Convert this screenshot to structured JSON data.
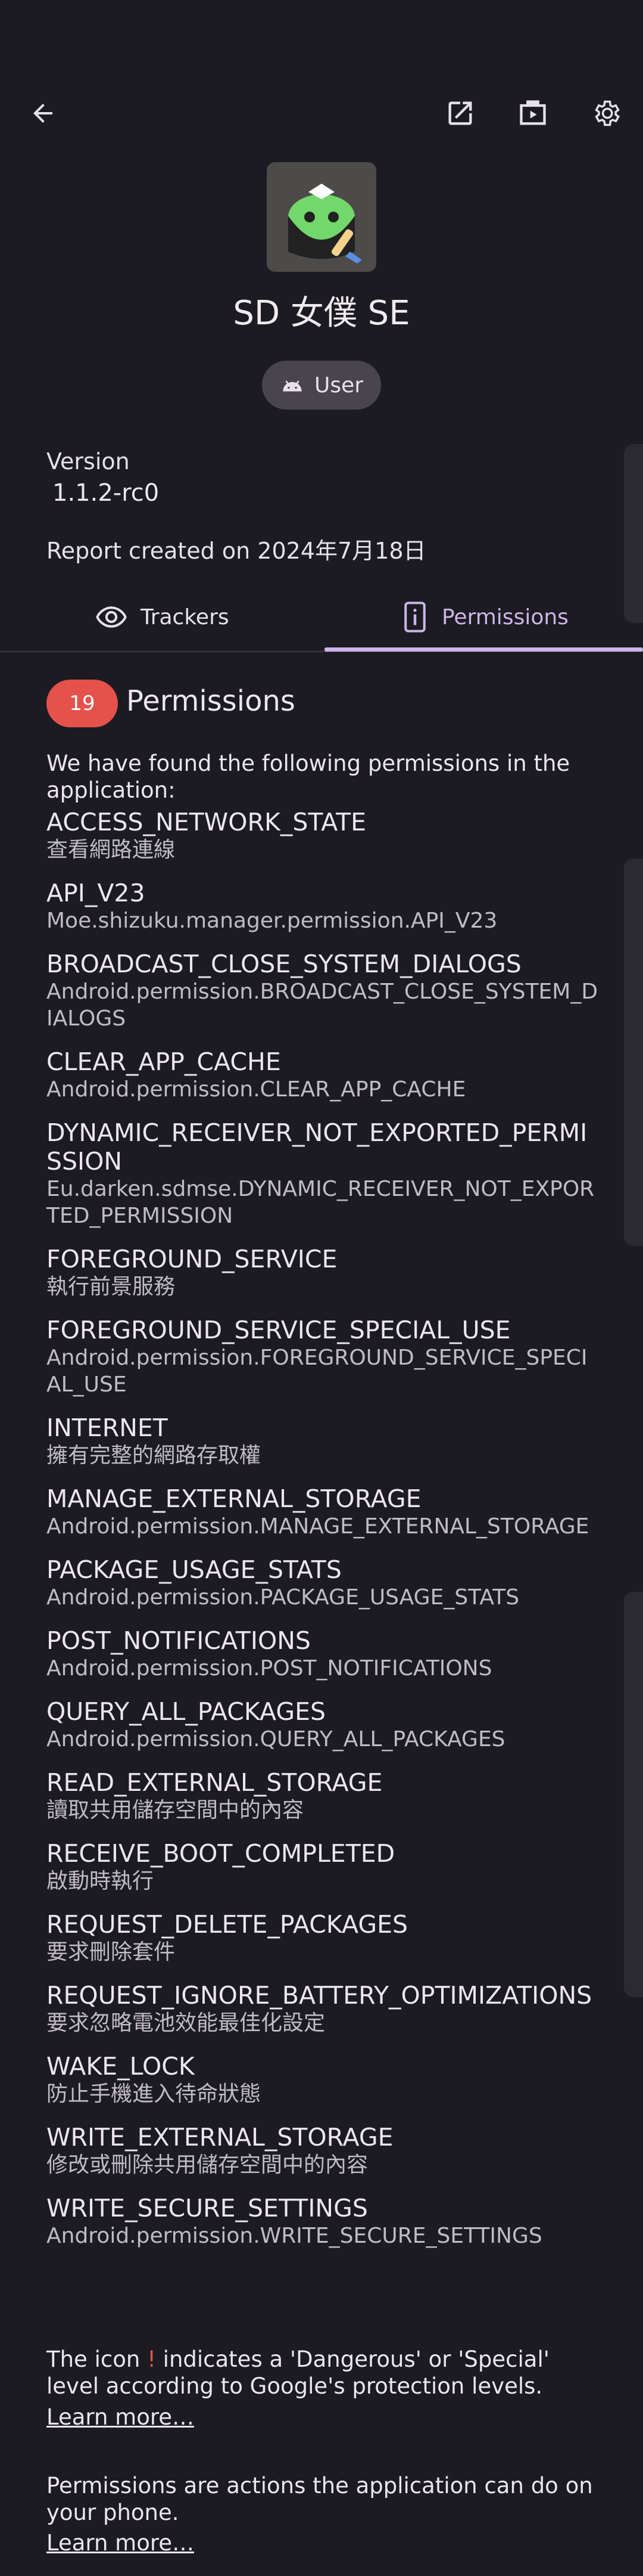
{
  "header": {
    "back_icon": "arrow-left-icon",
    "open_icon": "open-external-icon",
    "store_icon": "app-store-icon",
    "settings_icon": "gear-icon"
  },
  "app": {
    "name": "SD 女僕 SE",
    "type_label": "User"
  },
  "info": {
    "version_label": "Version",
    "version_value": "1.1.2-rc0",
    "report_created": "Report created on 2024年7月18日"
  },
  "tabs": [
    {
      "label": "Trackers",
      "icon": "eye-icon",
      "selected": false
    },
    {
      "label": "Permissions",
      "icon": "phone-info-icon",
      "selected": true
    }
  ],
  "permissions": {
    "count": "19",
    "title": "Permissions",
    "intro": "We have found the following permissions in the application:",
    "items": [
      {
        "name": "ACCESS_NETWORK_STATE",
        "desc": "查看網路連線"
      },
      {
        "name": "API_V23",
        "desc": "Moe.shizuku.manager.permission.API_V23"
      },
      {
        "name": "BROADCAST_CLOSE_SYSTEM_DIALOGS",
        "desc": "Android.permission.BROADCAST_CLOSE_SYSTEM_DIALOGS"
      },
      {
        "name": "CLEAR_APP_CACHE",
        "desc": "Android.permission.CLEAR_APP_CACHE"
      },
      {
        "name": "DYNAMIC_RECEIVER_NOT_EXPORTED_PERMISSION",
        "desc": "Eu.darken.sdmse.DYNAMIC_RECEIVER_NOT_EXPORTED_PERMISSION"
      },
      {
        "name": "FOREGROUND_SERVICE",
        "desc": "執行前景服務"
      },
      {
        "name": "FOREGROUND_SERVICE_SPECIAL_USE",
        "desc": "Android.permission.FOREGROUND_SERVICE_SPECIAL_USE"
      },
      {
        "name": "INTERNET",
        "desc": "擁有完整的網路存取權"
      },
      {
        "name": "MANAGE_EXTERNAL_STORAGE",
        "desc": "Android.permission.MANAGE_EXTERNAL_STORAGE"
      },
      {
        "name": "PACKAGE_USAGE_STATS",
        "desc": "Android.permission.PACKAGE_USAGE_STATS"
      },
      {
        "name": "POST_NOTIFICATIONS",
        "desc": "Android.permission.POST_NOTIFICATIONS"
      },
      {
        "name": "QUERY_ALL_PACKAGES",
        "desc": "Android.permission.QUERY_ALL_PACKAGES"
      },
      {
        "name": "READ_EXTERNAL_STORAGE",
        "desc": "讀取共用儲存空間中的內容"
      },
      {
        "name": "RECEIVE_BOOT_COMPLETED",
        "desc": "啟動時執行"
      },
      {
        "name": "REQUEST_DELETE_PACKAGES",
        "desc": "要求刪除套件"
      },
      {
        "name": "REQUEST_IGNORE_BATTERY_OPTIMIZATIONS",
        "desc": "要求忽略電池效能最佳化設定"
      },
      {
        "name": "WAKE_LOCK",
        "desc": "防止手機進入待命狀態"
      },
      {
        "name": "WRITE_EXTERNAL_STORAGE",
        "desc": "修改或刪除共用儲存空間中的內容"
      },
      {
        "name": "WRITE_SECURE_SETTINGS",
        "desc": "Android.permission.WRITE_SECURE_SETTINGS"
      }
    ]
  },
  "footer": {
    "icon_note_prefix": "The icon ",
    "icon_note_mark": "!",
    "icon_note_suffix": " indicates a 'Dangerous' or 'Special' level according to Google's protection levels.",
    "learn_more_1": "Learn more…",
    "explanation": "Permissions are actions the application can do on your phone.",
    "learn_more_2": "Learn more…"
  },
  "colors": {
    "background": "#1c1b21",
    "accent": "#cbb6e9",
    "badge": "#e5514b",
    "chip": "#48454e"
  }
}
